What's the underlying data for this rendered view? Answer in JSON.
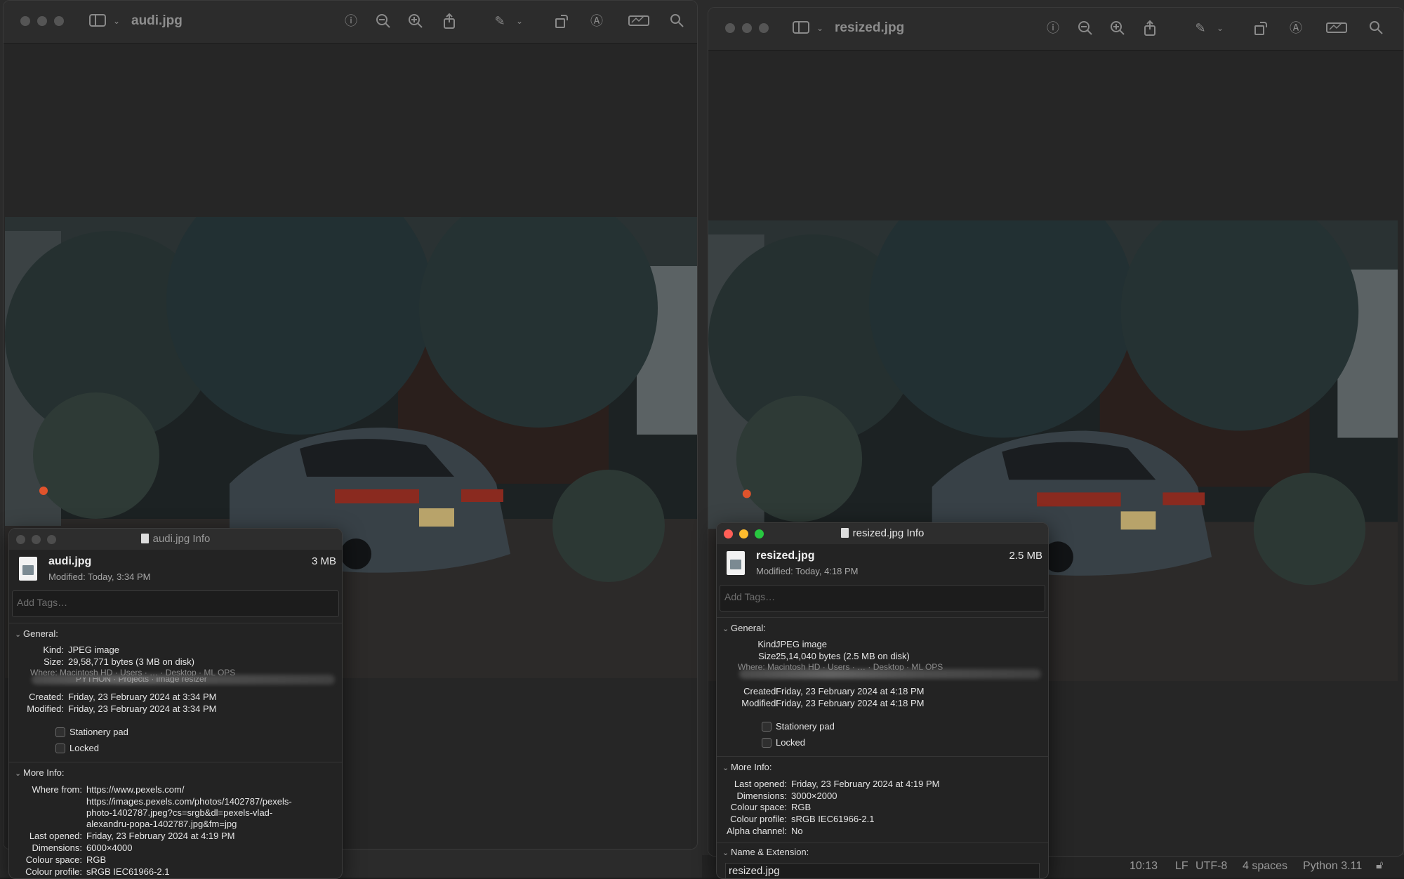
{
  "left_window": {
    "title": "audi.jpg",
    "toolbar_icons": [
      "sidebar-icon",
      "chevron-down-icon",
      "info-icon",
      "zoom-out-icon",
      "zoom-in-icon",
      "share-icon",
      "markup-pen-icon",
      "chevron-down-icon",
      "rotate-icon",
      "markup-icon",
      "signature-icon",
      "search-icon"
    ]
  },
  "right_window": {
    "title": "resized.jpg"
  },
  "left_info": {
    "window_title": "audi.jpg Info",
    "file_name": "audi.jpg",
    "modified": "Modified: Today, 3:34 PM",
    "size": "3 MB",
    "tags_placeholder": "Add Tags…",
    "general_label": "General:",
    "kind_key": "Kind:",
    "kind_val": "JPEG image",
    "size_key": "Size:",
    "size_val": "29,58,771 bytes (3 MB on disk)",
    "where_partial": "Where: Macintosh HD · Users · … · Desktop · ML OPS",
    "where_partial2": "PYTHON · Projects · image resizer",
    "created_key": "Created:",
    "created_val": "Friday, 23 February 2024 at 3:34 PM",
    "modified_key": "Modified:",
    "modified_val": "Friday, 23 February 2024 at 3:34 PM",
    "stationery": "Stationery pad",
    "locked": "Locked",
    "more_info_label": "More Info:",
    "where_from_key": "Where from:",
    "where_from_1": "https://www.pexels.com/",
    "where_from_2": "https://images.pexels.com/photos/1402787/pexels-",
    "where_from_3": "photo-1402787.jpeg?cs=srgb&dl=pexels-vlad-",
    "where_from_4": "alexandru-popa-1402787.jpg&fm=jpg",
    "last_opened_key": "Last opened:",
    "last_opened_val": "Friday, 23 February 2024 at 4:19 PM",
    "dimensions_key": "Dimensions:",
    "dimensions_val": "6000×4000",
    "colour_space_key": "Colour space:",
    "colour_space_val": "RGB",
    "colour_profile_key": "Colour profile:",
    "colour_profile_val": "sRGB IEC61966-2.1"
  },
  "right_info": {
    "window_title": "resized.jpg Info",
    "file_name": "resized.jpg",
    "modified": "Modified: Today, 4:18 PM",
    "size": "2.5 MB",
    "tags_placeholder": "Add Tags…",
    "general_label": "General:",
    "kind_key": "Kind:",
    "kind_val": "JPEG image",
    "size_key": "Size:",
    "size_val": "25,14,040 bytes (2.5 MB on disk)",
    "where_partial": "Where: Macintosh HD · Users · … · Desktop · ML OPS",
    "created_key": "Created:",
    "created_val": "Friday, 23 February 2024 at 4:18 PM",
    "modified_key": "Modified:",
    "modified_val": "Friday, 23 February 2024 at 4:18 PM",
    "stationery": "Stationery pad",
    "locked": "Locked",
    "more_info_label": "More Info:",
    "last_opened_key": "Last opened:",
    "last_opened_val": "Friday, 23 February 2024 at 4:19 PM",
    "dimensions_key": "Dimensions:",
    "dimensions_val": "3000×2000",
    "colour_space_key": "Colour space:",
    "colour_space_val": "RGB",
    "colour_profile_key": "Colour profile:",
    "colour_profile_val": "sRGB IEC61966-2.1",
    "alpha_key": "Alpha channel:",
    "alpha_val": "No",
    "name_ext_label": "Name & Extension:",
    "name_value": "resized.jpg"
  },
  "statusbar": {
    "position": "10:13",
    "line_ending": "LF",
    "encoding": "UTF-8",
    "indent": "4 spaces",
    "interpreter": "Python 3.11"
  },
  "colors": {
    "close": "#ff5f57",
    "minimize": "#febc2e",
    "zoom": "#28c840",
    "inactive_light": "#4d4d4d"
  }
}
